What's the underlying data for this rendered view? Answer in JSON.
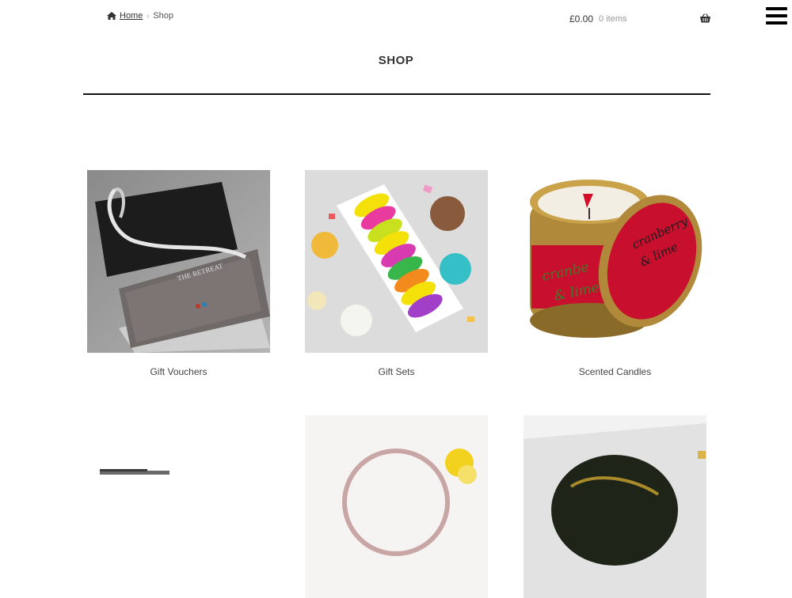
{
  "breadcrumb": {
    "home_label": "Home",
    "separator": "›",
    "current": "Shop"
  },
  "cart": {
    "amount": "£0.00",
    "items": "0 items"
  },
  "page": {
    "title": "SHOP"
  },
  "products": [
    {
      "name": "Gift Vouchers",
      "image": "gift-voucher-box-image"
    },
    {
      "name": "Gift Sets",
      "image": "macarons-box-image"
    },
    {
      "name": "Scented Candles",
      "image": "cranberry-lime-candle-tin-image"
    },
    {
      "name": "",
      "image": "partial-product-image"
    },
    {
      "name": "",
      "image": "partial-product-image"
    },
    {
      "name": "",
      "image": "partial-product-image"
    }
  ],
  "icons": {
    "home": "home-icon",
    "basket": "basket-icon",
    "menu": "hamburger-menu-icon"
  },
  "colors": {
    "text": "#333333",
    "rule": "#111111",
    "candle_red": "#c8102e"
  }
}
